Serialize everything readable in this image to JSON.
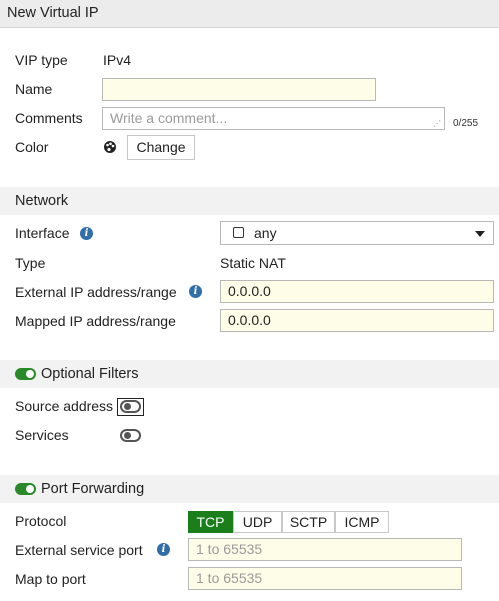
{
  "window": {
    "title": "New Virtual IP"
  },
  "general": {
    "vip_type_label": "VIP type",
    "vip_type_value": "IPv4",
    "name_label": "Name",
    "name_value": "",
    "comments_label": "Comments",
    "comments_placeholder": "Write a comment...",
    "comments_counter": "0/255",
    "color_label": "Color",
    "change_button": "Change"
  },
  "network": {
    "header": "Network",
    "interface_label": "Interface",
    "interface_value": "any",
    "type_label": "Type",
    "type_value": "Static NAT",
    "external_ip_label": "External IP address/range",
    "external_ip_value": "0.0.0.0",
    "mapped_ip_label": "Mapped IP address/range",
    "mapped_ip_value": "0.0.0.0"
  },
  "optional_filters": {
    "header": "Optional Filters",
    "enabled": true,
    "source_address_label": "Source address",
    "source_address_enabled": false,
    "services_label": "Services",
    "services_enabled": false
  },
  "port_forwarding": {
    "header": "Port Forwarding",
    "enabled": true,
    "protocol_label": "Protocol",
    "protocols": [
      "TCP",
      "UDP",
      "SCTP",
      "ICMP"
    ],
    "selected_protocol": "TCP",
    "external_port_label": "External service port",
    "external_port_placeholder": "1 to 65535",
    "map_to_port_label": "Map to port",
    "map_to_port_placeholder": "1 to 65535"
  },
  "colors": {
    "accent_green": "#1a7f1a",
    "info_blue": "#2f6ea8",
    "field_bg": "#fdfde8"
  }
}
